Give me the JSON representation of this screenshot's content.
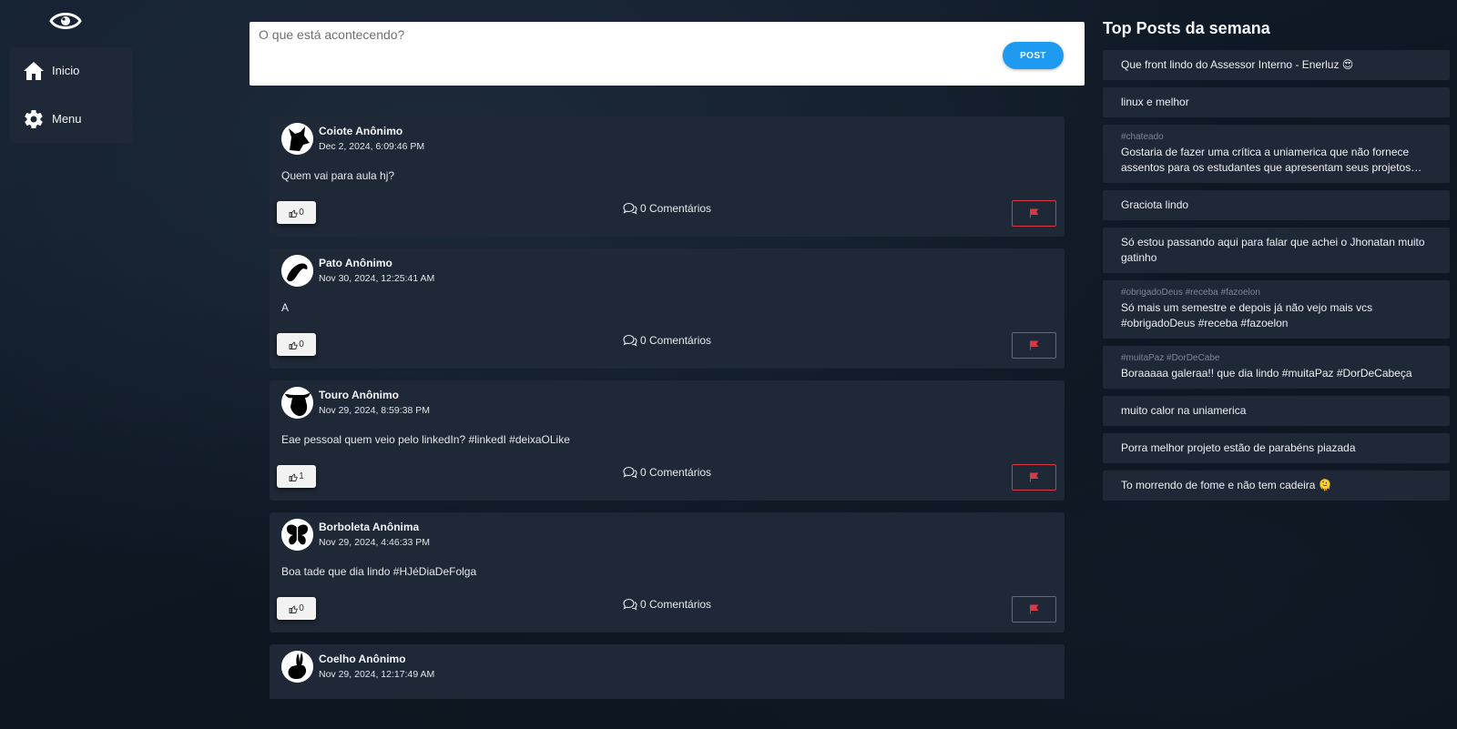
{
  "sidebar": {
    "logo_icon": "eye-icon",
    "items": [
      {
        "label": "Inicio",
        "icon": "home-icon"
      },
      {
        "label": "Menu",
        "icon": "gear-icon"
      }
    ]
  },
  "composer": {
    "placeholder": "O que está acontecendo?",
    "post_label": "POST",
    "post_color": "#1e9bf0"
  },
  "feed": {
    "posts": [
      {
        "author": "Coiote Anônimo",
        "date": "Dec 2, 2024, 6:09:46 PM",
        "content": "Quem vai para aula hj?",
        "likes": "0",
        "comments": "0 Comentários",
        "avatar": "coyote-avatar-icon"
      },
      {
        "author": "Pato Anônimo",
        "date": "Nov 30, 2024, 12:25:41 AM",
        "content": "A",
        "likes": "0",
        "comments": "0 Comentários",
        "avatar": "duck-avatar-icon"
      },
      {
        "author": "Touro Anônimo",
        "date": "Nov 29, 2024, 8:59:38 PM",
        "content": "Eae pessoal quem veio pelo linkedIn? #linkedI #deixaOLike",
        "likes": "1",
        "comments": "0 Comentários",
        "avatar": "bull-avatar-icon"
      },
      {
        "author": "Borboleta Anônima",
        "date": "Nov 29, 2024, 4:46:33 PM",
        "content": "Boa tade que dia lindo #HJéDiaDeFolga",
        "likes": "0",
        "comments": "0 Comentários",
        "avatar": "butterfly-avatar-icon"
      },
      {
        "author": "Coelho Anônimo",
        "date": "Nov 29, 2024, 12:17:49 AM",
        "content": "",
        "likes": "",
        "comments": "",
        "avatar": "rabbit-avatar-icon"
      }
    ],
    "flag_color": "#d83a45"
  },
  "top_posts": {
    "title": "Top Posts da semana",
    "items": [
      {
        "tags": "",
        "text": "Que front lindo do Assessor Interno - Enerluz 😍"
      },
      {
        "tags": "",
        "text": "linux e melhor"
      },
      {
        "tags": "#chateado",
        "text": "Gostaria de fazer uma crítica a uniamerica que não fornece assentos para os estudantes que apresentam seus projetos…"
      },
      {
        "tags": "",
        "text": "Graciota lindo"
      },
      {
        "tags": "",
        "text": "Só estou passando aqui para falar que achei o Jhonatan muito gatinho"
      },
      {
        "tags": "#obrigadoDeus #receba #fazoelon",
        "text": "Só mais um semestre e depois já não vejo mais vcs #obrigadoDeus #receba #fazoelon"
      },
      {
        "tags": "#muitaPaz #DorDeCabe",
        "text": "Boraaaaa galeraa!! que dia lindo #muitaPaz #DorDeCabeça"
      },
      {
        "tags": "",
        "text": "muito calor na uniamerica"
      },
      {
        "tags": "",
        "text": "Porra melhor projeto estão de parabéns piazada"
      },
      {
        "tags": "",
        "text": "To morrendo de fome e não tem cadeira 🫠"
      }
    ]
  }
}
